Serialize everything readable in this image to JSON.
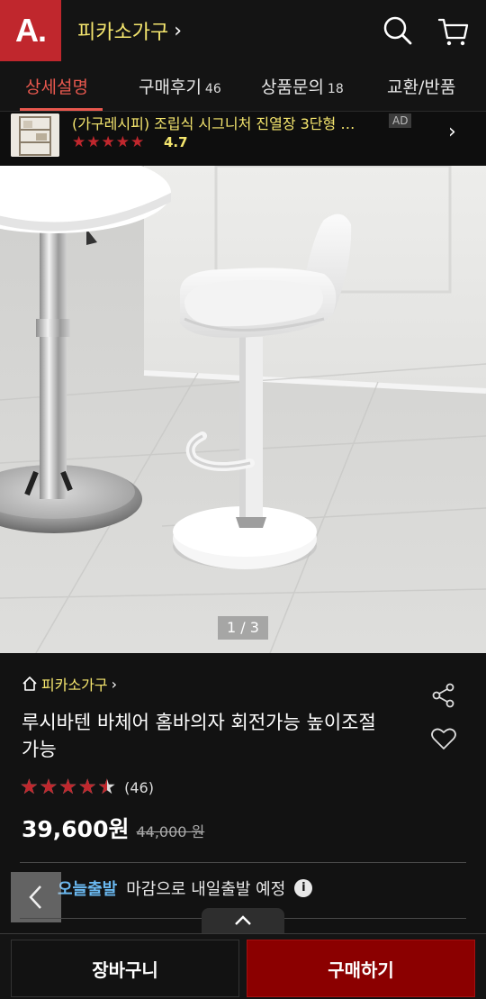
{
  "header": {
    "logo_text": "A.",
    "store_title": "피카소가구",
    "chevron": "›"
  },
  "tabs": [
    {
      "label": "상세설명",
      "count": ""
    },
    {
      "label": "구매후기",
      "count": "46"
    },
    {
      "label": "상품문의",
      "count": "18"
    },
    {
      "label": "교환/반품",
      "count": ""
    }
  ],
  "ad": {
    "title": "(가구레시피) 조립식 시그니처 진열장 3단형 …",
    "stars": "★★★★★",
    "rating": "4.7",
    "badge": "AD",
    "arrow": "›"
  },
  "hero": {
    "counter": "1 / 3"
  },
  "product": {
    "store_link": "피카소가구",
    "store_link_chevron": "›",
    "name": "루시바텐 바체어 홈바의자 회전가능 높이조절가능",
    "stars": "★★★★★",
    "rating_value": 4.5,
    "review_count": "(46)",
    "price": "39,600원",
    "original_price": "44,000 원"
  },
  "shipping": {
    "tag": "오늘출발",
    "text": "마감으로 내일출발 예정",
    "info_icon": "i"
  },
  "bottom": {
    "cart_label": "장바구니",
    "buy_label": "구매하기"
  },
  "colors": {
    "brand_red": "#c0272d",
    "store_yellow": "#f5e66e",
    "tab_active": "#e8584e",
    "buy_button": "#8b0000",
    "ship_blue": "#6ab8f0"
  }
}
